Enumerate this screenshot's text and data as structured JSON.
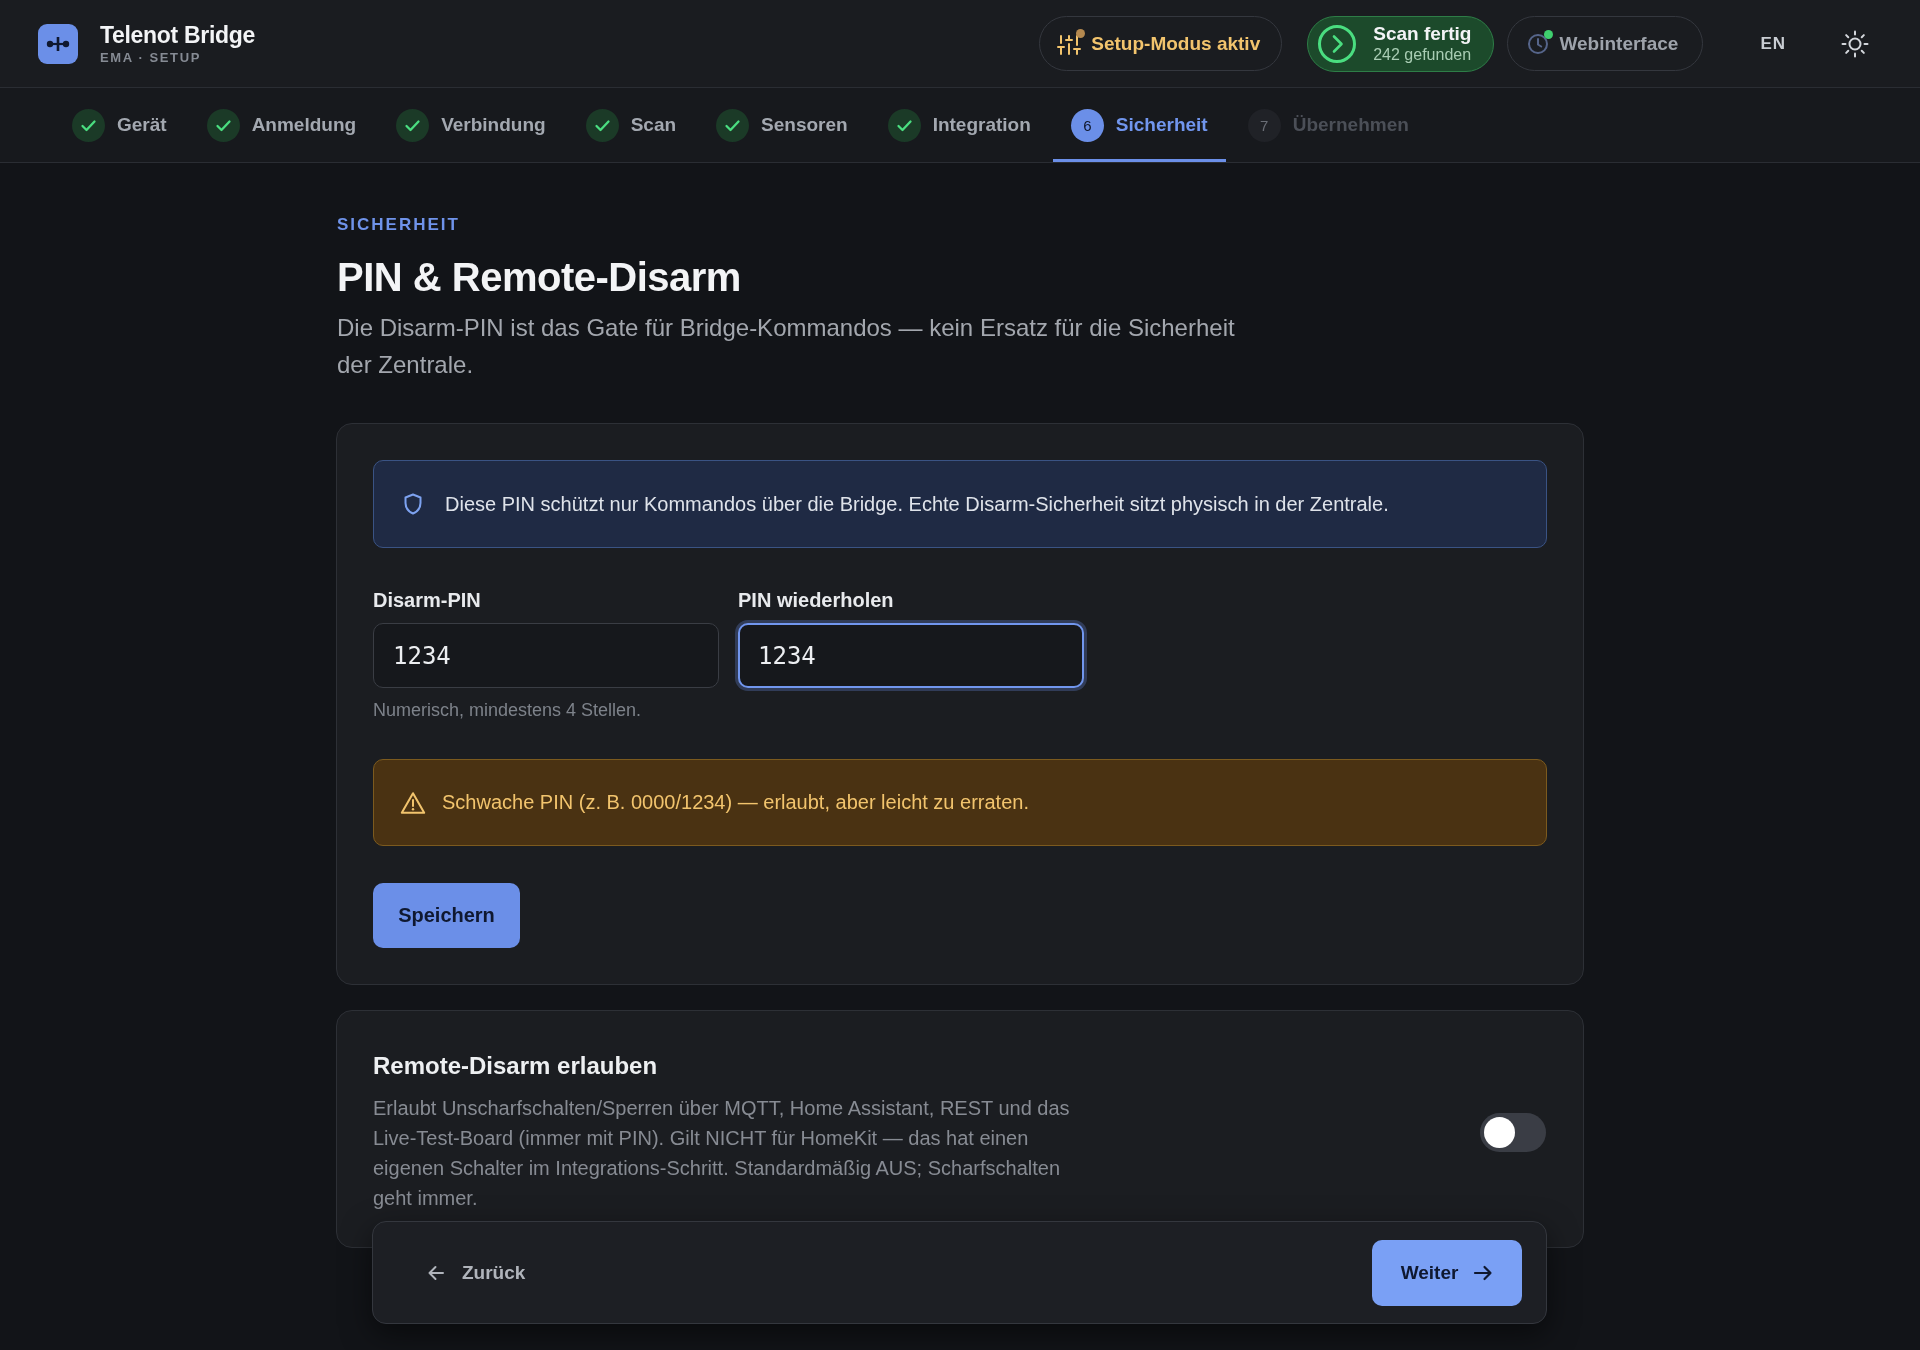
{
  "app": {
    "title": "Telenot Bridge",
    "subtitle": "EMA · SETUP"
  },
  "header": {
    "chips": [
      {
        "kind": "setup",
        "label": "Setup-Modus aktiv",
        "color": "#b5894f"
      },
      {
        "kind": "scan",
        "label": "Scan fertig",
        "detail": "242 gefunden"
      },
      {
        "kind": "web",
        "label": "Webinterface",
        "color": "#3fcf6e"
      }
    ],
    "language": "EN"
  },
  "steps": [
    {
      "label": "Gerät",
      "done": true,
      "selected": false
    },
    {
      "label": "Anmeldung",
      "done": true,
      "selected": false
    },
    {
      "label": "Verbindung",
      "done": true,
      "selected": false
    },
    {
      "label": "Scan",
      "done": true,
      "selected": false
    },
    {
      "label": "Sensoren",
      "done": true,
      "selected": false
    },
    {
      "label": "Integration",
      "done": true,
      "selected": false
    },
    {
      "number": "6",
      "label": "Sicherheit",
      "done": false,
      "selected": true
    },
    {
      "number": "7",
      "label": "Übernehmen",
      "done": false,
      "selected": false
    }
  ],
  "section": {
    "eyebrow": "SICHERHEIT",
    "title": "PIN & Remote-Disarm",
    "description": "Die Disarm-PIN ist das Gate für Bridge-Kommandos — kein Ersatz für die Sicherheit der Zentrale."
  },
  "pin_card": {
    "info": "Diese PIN schützt nur Kommandos über die Bridge. Echte Disarm-Sicherheit sitzt physisch in der Zentrale.",
    "fields": [
      {
        "label": "Disarm-PIN",
        "value": "1234",
        "focused": false,
        "hint": "Numerisch, mindestens 4 Stellen."
      },
      {
        "label": "PIN wiederholen",
        "value": "1234",
        "focused": true
      }
    ],
    "warning": "Schwache PIN (z. B. 0000/1234) — erlaubt, aber leicht zu erraten.",
    "save_button": "Speichern"
  },
  "remote_card": {
    "title": "Remote-Disarm erlauben",
    "description": "Erlaubt Unscharfschalten/Sperren über MQTT, Home Assistant, REST und das Live-Test-Board (immer mit PIN). Gilt NICHT für HomeKit — das hat einen eigenen Schalter im Integrations-Schritt. Standardmäßig AUS; Scharfschalten geht immer.",
    "on": false
  },
  "footer": {
    "back_button": "Zurück",
    "next_button": "Weiter"
  }
}
